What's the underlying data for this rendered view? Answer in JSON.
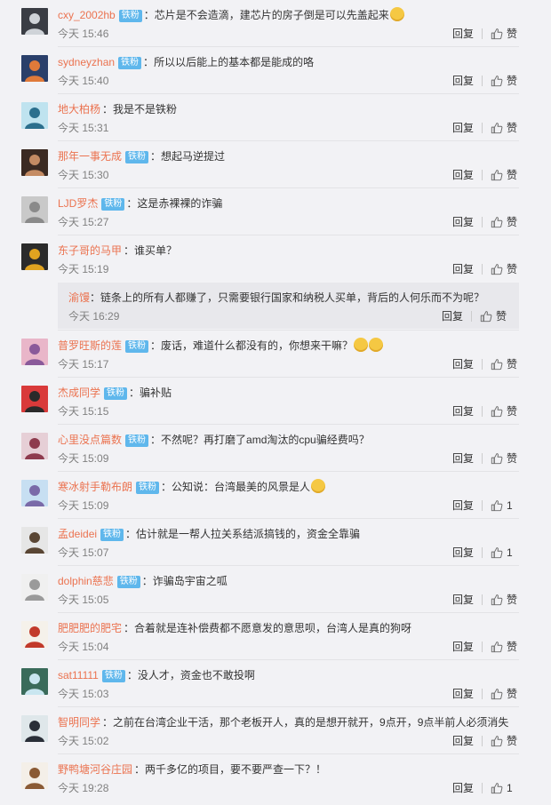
{
  "comments": [
    {
      "user": "cxy_2002hb",
      "badge": "铁粉",
      "text": "芯片是不会造滴，建芯片的房子倒是可以先盖起来",
      "emoji": true,
      "time": "今天 15:46",
      "likes": "赞",
      "avatar": {
        "bg": "#3a3d44",
        "fg": "#cfd3d8"
      }
    },
    {
      "user": "sydneyzhan",
      "badge": "铁粉",
      "text": "所以以后能上的基本都是能成的咯",
      "emoji": false,
      "time": "今天 15:40",
      "likes": "赞",
      "avatar": {
        "bg": "#2a3f6a",
        "fg": "#e07a3a"
      }
    },
    {
      "user": "地大柏杨",
      "badge": "",
      "text": "我是不是铁粉",
      "emoji": false,
      "time": "今天 15:31",
      "likes": "赞",
      "avatar": {
        "bg": "#bfe3ef",
        "fg": "#2b6f8d"
      }
    },
    {
      "user": "那年一事无成",
      "badge": "铁粉",
      "text": "想起马逆提过",
      "emoji": false,
      "time": "今天 15:30",
      "likes": "赞",
      "avatar": {
        "bg": "#3b2a22",
        "fg": "#c48b63"
      }
    },
    {
      "user": "LJD罗杰",
      "badge": "铁粉",
      "text": "这是赤裸裸的诈骗",
      "emoji": false,
      "time": "今天 15:27",
      "likes": "赞",
      "avatar": {
        "bg": "#c9c9c9",
        "fg": "#8a8a8a"
      }
    },
    {
      "user": "东子哥的马甲",
      "badge": "",
      "text": "谁买单？",
      "emoji": false,
      "time": "今天 15:19",
      "likes": "赞",
      "avatar": {
        "bg": "#2b2b2b",
        "fg": "#e0a320"
      },
      "reply": {
        "user": "渝馒",
        "text": "链条上的所有人都赚了，只需要银行国家和纳税人买单，背后的人何乐而不为呢？",
        "time": "今天 16:29",
        "likes": "赞"
      }
    },
    {
      "user": "普罗旺斯的莲",
      "badge": "铁粉",
      "text": "废话，难道什么都没有的，你想来干嘛？",
      "emoji": true,
      "emoji2": true,
      "time": "今天 15:17",
      "likes": "赞",
      "avatar": {
        "bg": "#e9b6c9",
        "fg": "#8a5a9a"
      }
    },
    {
      "user": "杰成同学",
      "badge": "铁粉",
      "text": "骗补贴",
      "emoji": false,
      "time": "今天 15:15",
      "likes": "赞",
      "avatar": {
        "bg": "#d93a3a",
        "fg": "#2a2a2a"
      }
    },
    {
      "user": "心里没点篇数",
      "badge": "铁粉",
      "text": "不然呢？再打磨了amd淘汰的cpu骗经费吗？",
      "emoji": false,
      "time": "今天 15:09",
      "likes": "赞",
      "avatar": {
        "bg": "#e6cfd6",
        "fg": "#8e3b4e"
      }
    },
    {
      "user": "寒冰射手勒布朗",
      "badge": "铁粉",
      "text": "公知说：台湾最美的风景是人",
      "emoji": true,
      "time": "今天 15:09",
      "likes": "1",
      "avatar": {
        "bg": "#c7dff2",
        "fg": "#7a6aa8"
      }
    },
    {
      "user": "孟deidei",
      "badge": "铁粉",
      "text": "估计就是一帮人拉关系结派搞钱的，资金全靠骗",
      "emoji": false,
      "time": "今天 15:07",
      "likes": "1",
      "avatar": {
        "bg": "#e6e6e6",
        "fg": "#5a4634"
      }
    },
    {
      "user": "dolphin慈悲",
      "badge": "铁粉",
      "text": "诈骗岛宇宙之呱",
      "emoji": false,
      "time": "今天 15:05",
      "likes": "赞",
      "avatar": {
        "bg": "#f0f0f0",
        "fg": "#9a9a9a"
      }
    },
    {
      "user": "肥肥肥的肥宅",
      "badge": "",
      "text": "合着就是连补偿费都不愿意发的意思呗，台湾人是真的狗呀",
      "emoji": false,
      "time": "今天 15:04",
      "likes": "赞",
      "avatar": {
        "bg": "#f5f1ea",
        "fg": "#c23a2a"
      }
    },
    {
      "user": "sat11111",
      "badge": "铁粉",
      "text": "没人才，资金也不敢投啊",
      "emoji": false,
      "time": "今天 15:03",
      "likes": "赞",
      "avatar": {
        "bg": "#3a6b5a",
        "fg": "#c9e6f0"
      }
    },
    {
      "user": "智明同学",
      "badge": "",
      "text": "之前在台湾企业干活，那个老板开人，真的是想开就开，9点开，9点半前人必须消失",
      "emoji": false,
      "time": "今天 15:02",
      "likes": "赞",
      "avatar": {
        "bg": "#dfe7ea",
        "fg": "#2a2f38"
      }
    },
    {
      "user": "野鸭塘河谷庄园",
      "badge": "",
      "text": "两千多亿的项目，要不要严查一下？！",
      "emoji": false,
      "time": "今天 19:28",
      "likes": "1",
      "avatar": {
        "bg": "#f4efe8",
        "fg": "#8a5a34"
      }
    }
  ],
  "labels": {
    "reply": "回复",
    "colon": "："
  }
}
